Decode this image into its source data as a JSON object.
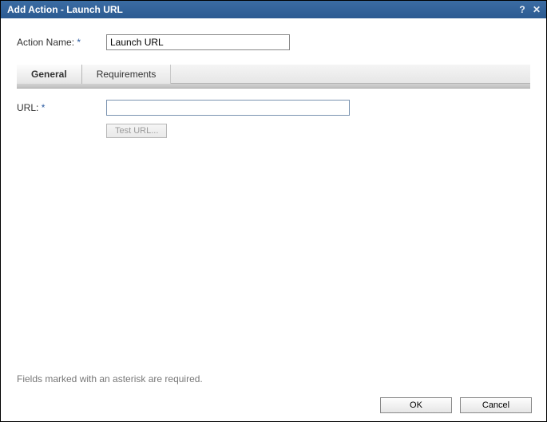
{
  "titlebar": {
    "title": "Add Action - Launch URL",
    "help_glyph": "?",
    "close_glyph": "✕"
  },
  "form": {
    "action_name_label": "Action Name:",
    "action_name_value": "Launch URL",
    "asterisk": "*"
  },
  "tabs": {
    "general": "General",
    "requirements": "Requirements"
  },
  "general_tab": {
    "url_label": "URL:",
    "url_value": "",
    "test_url_label": "Test URL..."
  },
  "footnote": "Fields marked with an asterisk are required.",
  "footer": {
    "ok": "OK",
    "cancel": "Cancel"
  }
}
